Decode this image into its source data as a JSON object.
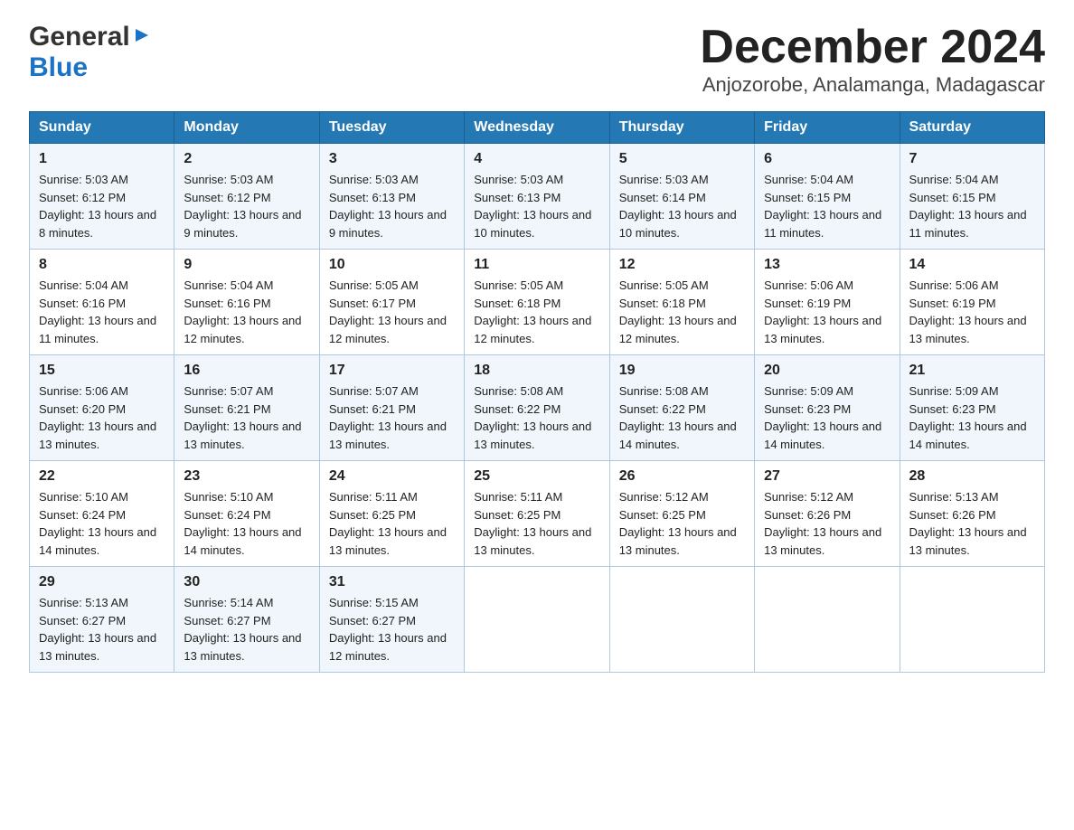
{
  "logo": {
    "general": "General",
    "blue": "Blue",
    "arrow": "▶"
  },
  "title": "December 2024",
  "subtitle": "Anjozorobe, Analamanga, Madagascar",
  "weekdays": [
    "Sunday",
    "Monday",
    "Tuesday",
    "Wednesday",
    "Thursday",
    "Friday",
    "Saturday"
  ],
  "weeks": [
    [
      {
        "day": "1",
        "sunrise": "5:03 AM",
        "sunset": "6:12 PM",
        "daylight": "13 hours and 8 minutes."
      },
      {
        "day": "2",
        "sunrise": "5:03 AM",
        "sunset": "6:12 PM",
        "daylight": "13 hours and 9 minutes."
      },
      {
        "day": "3",
        "sunrise": "5:03 AM",
        "sunset": "6:13 PM",
        "daylight": "13 hours and 9 minutes."
      },
      {
        "day": "4",
        "sunrise": "5:03 AM",
        "sunset": "6:13 PM",
        "daylight": "13 hours and 10 minutes."
      },
      {
        "day": "5",
        "sunrise": "5:03 AM",
        "sunset": "6:14 PM",
        "daylight": "13 hours and 10 minutes."
      },
      {
        "day": "6",
        "sunrise": "5:04 AM",
        "sunset": "6:15 PM",
        "daylight": "13 hours and 11 minutes."
      },
      {
        "day": "7",
        "sunrise": "5:04 AM",
        "sunset": "6:15 PM",
        "daylight": "13 hours and 11 minutes."
      }
    ],
    [
      {
        "day": "8",
        "sunrise": "5:04 AM",
        "sunset": "6:16 PM",
        "daylight": "13 hours and 11 minutes."
      },
      {
        "day": "9",
        "sunrise": "5:04 AM",
        "sunset": "6:16 PM",
        "daylight": "13 hours and 12 minutes."
      },
      {
        "day": "10",
        "sunrise": "5:05 AM",
        "sunset": "6:17 PM",
        "daylight": "13 hours and 12 minutes."
      },
      {
        "day": "11",
        "sunrise": "5:05 AM",
        "sunset": "6:18 PM",
        "daylight": "13 hours and 12 minutes."
      },
      {
        "day": "12",
        "sunrise": "5:05 AM",
        "sunset": "6:18 PM",
        "daylight": "13 hours and 12 minutes."
      },
      {
        "day": "13",
        "sunrise": "5:06 AM",
        "sunset": "6:19 PM",
        "daylight": "13 hours and 13 minutes."
      },
      {
        "day": "14",
        "sunrise": "5:06 AM",
        "sunset": "6:19 PM",
        "daylight": "13 hours and 13 minutes."
      }
    ],
    [
      {
        "day": "15",
        "sunrise": "5:06 AM",
        "sunset": "6:20 PM",
        "daylight": "13 hours and 13 minutes."
      },
      {
        "day": "16",
        "sunrise": "5:07 AM",
        "sunset": "6:21 PM",
        "daylight": "13 hours and 13 minutes."
      },
      {
        "day": "17",
        "sunrise": "5:07 AM",
        "sunset": "6:21 PM",
        "daylight": "13 hours and 13 minutes."
      },
      {
        "day": "18",
        "sunrise": "5:08 AM",
        "sunset": "6:22 PM",
        "daylight": "13 hours and 13 minutes."
      },
      {
        "day": "19",
        "sunrise": "5:08 AM",
        "sunset": "6:22 PM",
        "daylight": "13 hours and 14 minutes."
      },
      {
        "day": "20",
        "sunrise": "5:09 AM",
        "sunset": "6:23 PM",
        "daylight": "13 hours and 14 minutes."
      },
      {
        "day": "21",
        "sunrise": "5:09 AM",
        "sunset": "6:23 PM",
        "daylight": "13 hours and 14 minutes."
      }
    ],
    [
      {
        "day": "22",
        "sunrise": "5:10 AM",
        "sunset": "6:24 PM",
        "daylight": "13 hours and 14 minutes."
      },
      {
        "day": "23",
        "sunrise": "5:10 AM",
        "sunset": "6:24 PM",
        "daylight": "13 hours and 14 minutes."
      },
      {
        "day": "24",
        "sunrise": "5:11 AM",
        "sunset": "6:25 PM",
        "daylight": "13 hours and 13 minutes."
      },
      {
        "day": "25",
        "sunrise": "5:11 AM",
        "sunset": "6:25 PM",
        "daylight": "13 hours and 13 minutes."
      },
      {
        "day": "26",
        "sunrise": "5:12 AM",
        "sunset": "6:25 PM",
        "daylight": "13 hours and 13 minutes."
      },
      {
        "day": "27",
        "sunrise": "5:12 AM",
        "sunset": "6:26 PM",
        "daylight": "13 hours and 13 minutes."
      },
      {
        "day": "28",
        "sunrise": "5:13 AM",
        "sunset": "6:26 PM",
        "daylight": "13 hours and 13 minutes."
      }
    ],
    [
      {
        "day": "29",
        "sunrise": "5:13 AM",
        "sunset": "6:27 PM",
        "daylight": "13 hours and 13 minutes."
      },
      {
        "day": "30",
        "sunrise": "5:14 AM",
        "sunset": "6:27 PM",
        "daylight": "13 hours and 13 minutes."
      },
      {
        "day": "31",
        "sunrise": "5:15 AM",
        "sunset": "6:27 PM",
        "daylight": "13 hours and 12 minutes."
      },
      null,
      null,
      null,
      null
    ]
  ]
}
